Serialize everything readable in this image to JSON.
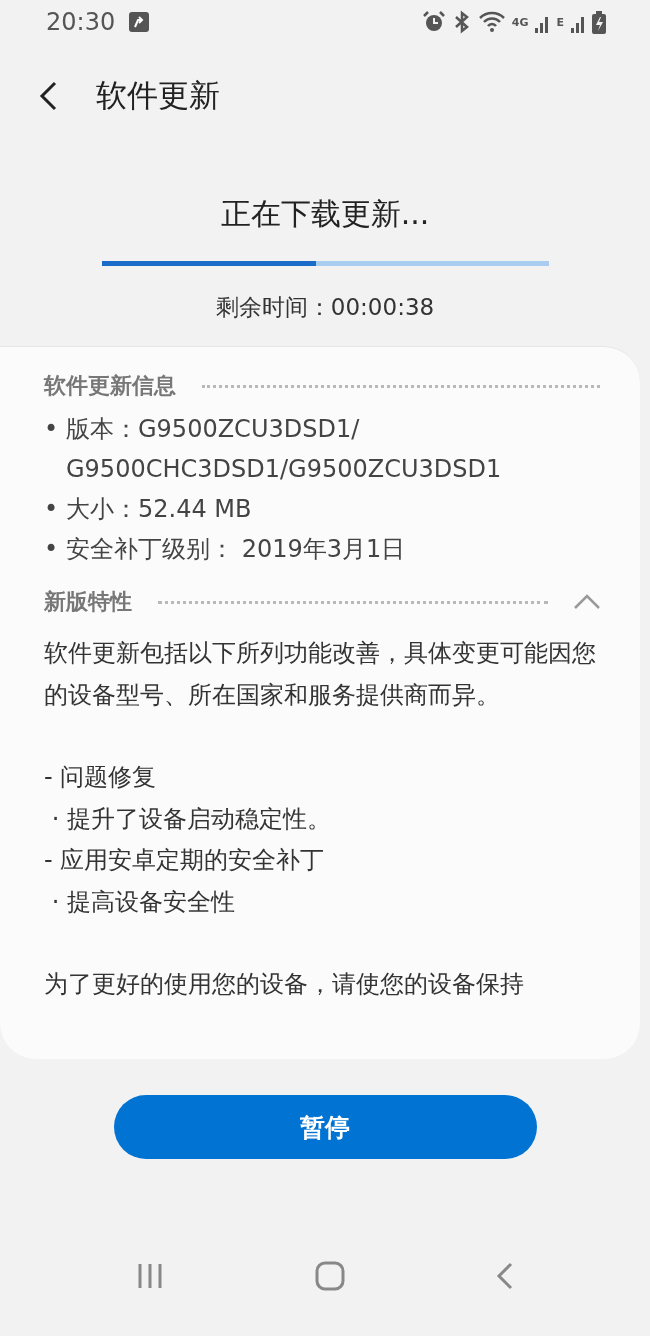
{
  "status_bar": {
    "time": "20:30",
    "network_4g": "4G",
    "network_e": "E"
  },
  "header": {
    "title": "软件更新"
  },
  "download": {
    "title": "正在下载更新...",
    "level": 0.48,
    "remaining": "剩余时间：00:00:38"
  },
  "info": {
    "title": "软件更新信息",
    "items": [
      {
        "bullet": "•",
        "text": "版本：G9500ZCU3DSD1/\nG9500CHC3DSD1/G9500ZCU3DSD1"
      },
      {
        "bullet": "•",
        "text": "大小：52.44 MB"
      },
      {
        "bullet": "•",
        "text": "安全补丁级别： 2019年3月1日"
      }
    ]
  },
  "features": {
    "title": "新版特性",
    "expanded": true,
    "intro": "软件更新包括以下所列功能改善，具体变更可能因您的设备型号、所在国家和服务提供商而异。",
    "lines": [
      "- 问题修复",
      " · 提升了设备启动稳定性。",
      "- 应用安卓定期的安全补丁",
      " · 提高设备安全性"
    ],
    "footer": "为了更好的使用您的设备，请使您的设备保持"
  },
  "button": {
    "label": "暂停"
  }
}
